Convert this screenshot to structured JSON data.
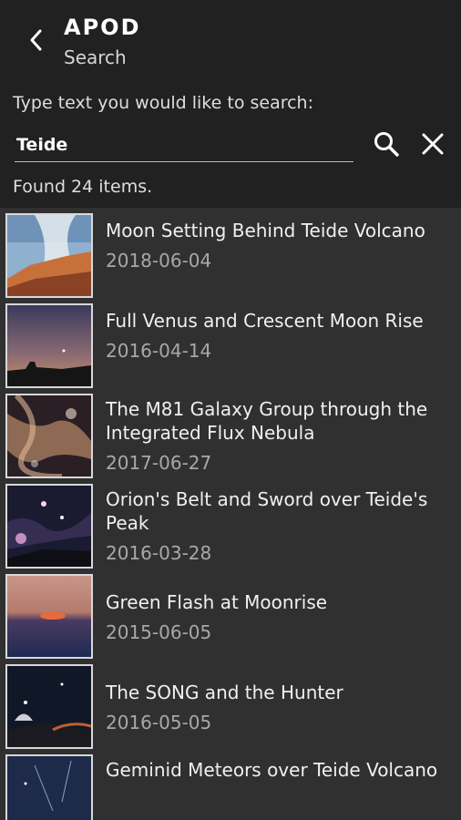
{
  "appbar": {
    "title": "APOD",
    "subtitle": "Search"
  },
  "search": {
    "prompt": "Type text you would like to search:",
    "value": "Teide",
    "found_text": "Found 24 items."
  },
  "results": [
    {
      "title": "Moon Setting Behind Teide Volcano",
      "date": "2018-06-04"
    },
    {
      "title": "Full Venus and Crescent Moon Rise",
      "date": "2016-04-14"
    },
    {
      "title": "The M81 Galaxy Group through the Integrated Flux Nebula",
      "date": "2017-06-27"
    },
    {
      "title": "Orion's Belt and Sword over Teide's Peak",
      "date": "2016-03-28"
    },
    {
      "title": "Green Flash at Moonrise",
      "date": "2015-06-05"
    },
    {
      "title": "The SONG and the Hunter",
      "date": "2016-05-05"
    },
    {
      "title": "Geminid Meteors over Teide Volcano",
      "date": ""
    }
  ]
}
